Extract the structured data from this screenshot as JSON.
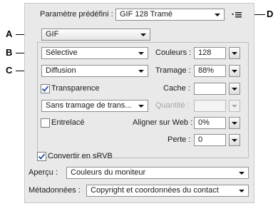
{
  "preset": {
    "label": "Paramètre prédéfini :",
    "value": "GIF 128 Tramé"
  },
  "format": {
    "value": "GIF"
  },
  "reduction": {
    "value": "Sélective"
  },
  "dither_algorithm": {
    "value": "Diffusion"
  },
  "transparency": {
    "label": "Transparence",
    "checked": true
  },
  "transparency_dither": {
    "value": "Sans tramage de trans..."
  },
  "interlaced": {
    "label": "Entrelacé",
    "checked": false
  },
  "colors": {
    "label": "Couleurs :",
    "value": "128"
  },
  "dither": {
    "label": "Tramage :",
    "value": "88%"
  },
  "matte": {
    "label": "Cache :",
    "value": ""
  },
  "amount": {
    "label": "Quantité :",
    "value": "",
    "enabled": false
  },
  "web_snap": {
    "label": "Aligner sur Web :",
    "value": "0%"
  },
  "lossy": {
    "label": "Perte :",
    "value": "0"
  },
  "convert_srgb": {
    "label": "Convertir en sRVB",
    "checked": true
  },
  "preview": {
    "label": "Aperçu :",
    "value": "Couleurs du moniteur"
  },
  "metadata": {
    "label": "Métadonnées :",
    "value": "Copyright et coordonnées du contact"
  },
  "callouts": {
    "a": "A",
    "b": "B",
    "c": "C",
    "d": "D"
  }
}
